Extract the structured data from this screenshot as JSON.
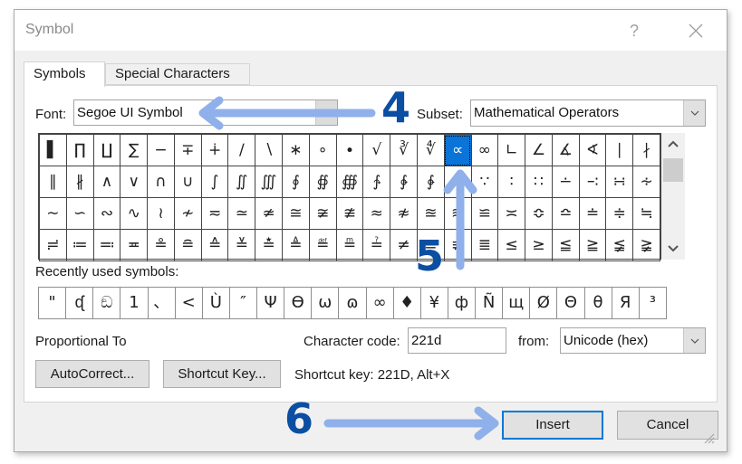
{
  "window": {
    "title": "Symbol",
    "help_label": "?",
    "close_icon": "close-icon"
  },
  "tabs": [
    {
      "label": "Symbols",
      "active": true
    },
    {
      "label": "Special Characters",
      "active": false
    }
  ],
  "font": {
    "label": "Font:",
    "value": "Segoe UI Symbol"
  },
  "subset": {
    "label": "Subset:",
    "value": "Mathematical Operators"
  },
  "symbol_grid": {
    "selected": "∝",
    "rows": [
      [
        "▌",
        "∏",
        "∐",
        "∑",
        "−",
        "∓",
        "∔",
        "∕",
        "∖",
        "∗",
        "∘",
        "∙",
        "√",
        "∛",
        "∜",
        "∝",
        "∞",
        "∟",
        "∠",
        "∡",
        "∢",
        "∣",
        "∤"
      ],
      [
        "∥",
        "∦",
        "∧",
        "∨",
        "∩",
        "∪",
        "∫",
        "∬",
        "∭",
        "∮",
        "∯",
        "∰",
        "∱",
        "∲",
        "∳",
        "∴",
        "∵",
        "∶",
        "∷",
        "∸",
        "∹",
        "∺",
        "∻"
      ],
      [
        "∼",
        "∽",
        "∾",
        "∿",
        "≀",
        "≁",
        "≂",
        "≃",
        "≄",
        "≅",
        "≆",
        "≇",
        "≈",
        "≉",
        "≊",
        "≋",
        "≌",
        "≍",
        "≎",
        "≏",
        "≐",
        "≑",
        "≒"
      ],
      [
        "≓",
        "≔",
        "≕",
        "≖",
        "≗",
        "≘",
        "≙",
        "≚",
        "≛",
        "≜",
        "≝",
        "≞",
        "≟",
        "≠",
        "≡",
        "≢",
        "≣",
        "≤",
        "≥",
        "≦",
        "≧",
        "≨",
        "≩"
      ]
    ]
  },
  "recent": {
    "label": "Recently used symbols:",
    "symbols": [
      "\"",
      "ᶑ",
      "ඞ",
      "1",
      "、",
      "<",
      "Ù",
      "″",
      "Ψ",
      "ϴ",
      "ω",
      "ɷ",
      "∞",
      "♦",
      "¥",
      "ф",
      "Ñ",
      "щ",
      "Ø",
      "Θ",
      "θ",
      "Я",
      "³"
    ]
  },
  "char_name": "Proportional To",
  "char_code": {
    "label": "Character code:",
    "value": "221d"
  },
  "from": {
    "label": "from:",
    "value": "Unicode (hex)"
  },
  "buttons": {
    "autocorrect": "AutoCorrect...",
    "shortcut_key": "Shortcut Key...",
    "insert": "Insert",
    "cancel": "Cancel"
  },
  "shortcut_text": "Shortcut key: 221D, Alt+X",
  "annotations": {
    "step4": "4",
    "step5": "5",
    "step6": "6",
    "arrow_color": "#8fb0ea",
    "number_color": "#0b4ea2"
  },
  "colors": {
    "selection": "#0a74d8",
    "default_button_border": "#0078d7"
  }
}
